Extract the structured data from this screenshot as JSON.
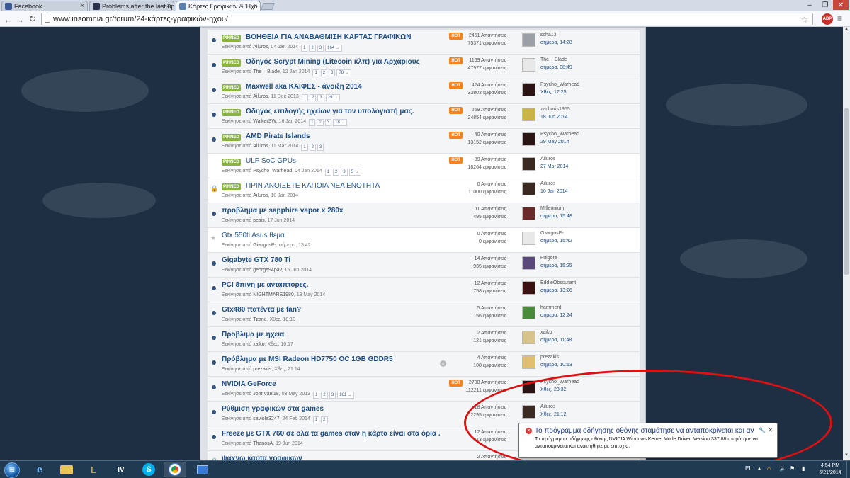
{
  "browser": {
    "tabs": [
      {
        "label": "Facebook",
        "color": "#3b5998"
      },
      {
        "label": "Problems after the last up",
        "color": "#2a2f4a"
      },
      {
        "label": "Κάρτες Γραφικών & Ήχο",
        "color": "#5a7fb0"
      }
    ],
    "url": "www.insomnia.gr/forum/24-κάρτες-γραφικών-ηχου/",
    "abp_label": "ABP"
  },
  "forum": {
    "pinned_label": "PINNED",
    "hot_label": "HOT",
    "started_by": "Ξεκίνησε από",
    "topics": [
      {
        "title": "ΒΟΗΘΕΙΑ ΓΙΑ ΑΝΑΒΑΘΜΙΣΗ ΚΑΡΤΑΣ ΓΡΑΦΙΚΩΝ",
        "pinned": true,
        "hot": true,
        "author": "Ailuros",
        "date": "04 Jan 2014",
        "pages": [
          "1",
          "2",
          "3",
          "164 →"
        ],
        "replies": "2451 Απαντήσεις",
        "views": "75371 εμφανίσεις",
        "last_user": "scha13",
        "last_date": "σήμερα, 14:28",
        "avatar": "#9aa0a6"
      },
      {
        "title": "Οδηγός Scrypt Mining (Litecoin κλπ) για Αρχάριους",
        "pinned": true,
        "hot": true,
        "author": "The__Blade",
        "date": "12 Jan 2014",
        "pages": [
          "1",
          "2",
          "3",
          "78 →"
        ],
        "replies": "1169 Απαντήσεις",
        "views": "47977 εμφανίσεις",
        "last_user": "The__Blade",
        "last_date": "σήμερα, 08:49",
        "avatar": "#e8e8e8"
      },
      {
        "title": "Maxwell aka ΚΑΙΦΕΣ - άνοιξη 2014",
        "pinned": true,
        "hot": true,
        "author": "Ailuros",
        "date": "11 Dec 2013",
        "pages": [
          "1",
          "2",
          "3",
          "29 →"
        ],
        "replies": "424 Απαντήσεις",
        "views": "33803 εμφανίσεις",
        "last_user": "Psycho_Warhead",
        "last_date": "Χθες, 17:25",
        "avatar": "#2a1414"
      },
      {
        "title": "Οδηγός επιλογής ηχείων για τον υπολογιστή μας.",
        "pinned": true,
        "hot": true,
        "author": "WalkerSW",
        "date": "16 Jan 2014",
        "pages": [
          "1",
          "2",
          "3",
          "18 →"
        ],
        "replies": "259 Απαντήσεις",
        "views": "24854 εμφανίσεις",
        "last_user": "zacharis1955",
        "last_date": "18 Jun 2014",
        "avatar": "#c9b44a"
      },
      {
        "title": "AMD Pirate Islands",
        "pinned": true,
        "hot": true,
        "author": "Ailuros",
        "date": "11 Mar 2014",
        "pages": [
          "1",
          "2",
          "3"
        ],
        "replies": "40 Απαντήσεις",
        "views": "13152 εμφανίσεις",
        "last_user": "Psycho_Warhead",
        "last_date": "29 May 2014",
        "avatar": "#2a1414"
      },
      {
        "title": "ULP SoC GPUs",
        "pinned": true,
        "hot": true,
        "light": true,
        "author": "Psycho_Warhead",
        "date": "04 Jan 2014",
        "pages": [
          "1",
          "2",
          "3",
          "5 →"
        ],
        "replies": "89 Απαντήσεις",
        "views": "18264 εμφανίσεις",
        "last_user": "Ailuros",
        "last_date": "27 Mar 2014",
        "avatar": "#3a2a22"
      },
      {
        "title": "ΠΡΙΝ ΑΝΟΙΞΕΤΕ ΚΑΠΟΙΑ ΝΕΑ ΕΝΟΤΗΤΑ",
        "pinned": true,
        "hot": false,
        "light": true,
        "locked": true,
        "author": "Ailuros",
        "date": "10 Jan 2014",
        "pages": [],
        "replies": "0 Απαντήσεις",
        "views": "11000 εμφανίσεις",
        "last_user": "Ailuros",
        "last_date": "10 Jan 2014",
        "avatar": "#3a2a22"
      },
      {
        "title": "προβλημα με sapphire vapor x 280x",
        "author": "pesis",
        "date": "17 Jun 2014",
        "pages": [],
        "replies": "11 Απαντήσεις",
        "views": "495 εμφανίσεις",
        "last_user": "Millennium",
        "last_date": "σήμερα, 15:48",
        "avatar": "#6b2a2a"
      },
      {
        "title": "Gtx 550ti Asus θεμα",
        "light": true,
        "star": true,
        "author": "GiwrgosP-",
        "date": "σήμερα, 15:42",
        "pages": [],
        "replies": "0 Απαντήσεις",
        "views": "0 εμφανίσεις",
        "last_user": "GiwrgosP-",
        "last_date": "σήμερα, 15:42",
        "avatar": "#e8e8e8"
      },
      {
        "title": "Gigabyte GTX 780 Ti",
        "author": "george94pav",
        "date": "15 Jun 2014",
        "pages": [],
        "replies": "14 Απαντήσεις",
        "views": "935 εμφανίσεις",
        "last_user": "Fulgore",
        "last_date": "σήμερα, 15:25",
        "avatar": "#5a4a7a"
      },
      {
        "title": "PCI 8πινη με ανταπτορες.",
        "author": "NIGHTMARE1980",
        "date": "13 May 2014",
        "pages": [],
        "replies": "12 Απαντήσεις",
        "views": "758 εμφανίσεις",
        "last_user": "EddieObscurant",
        "last_date": "σήμερα, 13:26",
        "avatar": "#3a1010"
      },
      {
        "title": "Gtx480 πατέντα με fan?",
        "author": "Tzane",
        "date": "Χθες, 18:10",
        "pages": [],
        "replies": "5 Απαντήσεις",
        "views": "156 εμφανίσεις",
        "last_user": "hammerd",
        "last_date": "σήμερα, 12:24",
        "avatar": "#4a8a3a"
      },
      {
        "title": "Προβλιμα με ηχεια",
        "author": "xaiko",
        "date": "Χθες, 16:17",
        "pages": [],
        "replies": "2 Απαντήσεις",
        "views": "121 εμφανίσεις",
        "last_user": "xaiko",
        "last_date": "σήμερα, 11:48",
        "avatar": "#d6c48a"
      },
      {
        "title": "Πρόβλημα με MSI Radeon HD7750 OC 1GB GDDR5",
        "mark": true,
        "author": "prezakis",
        "date": "Χθες, 21:14",
        "pages": [],
        "replies": "4 Απαντήσεις",
        "views": "108 εμφανίσεις",
        "last_user": "prezakis",
        "last_date": "σήμερα, 10:53",
        "avatar": "#e0c070"
      },
      {
        "title": "NVIDIA GeForce",
        "hot": true,
        "author": "JohnVani18",
        "date": "03 May 2013",
        "pages": [
          "1",
          "2",
          "3",
          "181 →"
        ],
        "replies": "2708 Απαντήσεις",
        "views": "112211 εμφανίσεις",
        "last_user": "Psycho_Warhead",
        "last_date": "Χθες, 23:32",
        "avatar": "#2a1414"
      },
      {
        "title": "Ρύθμιση γραφικών στα games",
        "author": "saviola3247",
        "date": "24 Feb 2014",
        "pages": [
          "1",
          "2"
        ],
        "replies": "18 Απαντήσεις",
        "views": "2295 εμφανίσεις",
        "last_user": "Ailuros",
        "last_date": "Χθες, 21:12",
        "avatar": "#3a2a22"
      },
      {
        "title": "Freeze με GTX 760 σε ολα τα games οταν η κάρτα είναι στα όρια .",
        "author": "ThanosA",
        "date": "19 Jun 2014",
        "pages": [],
        "replies": "12 Απαντήσεις",
        "views": "313 εμφανίσεις",
        "last_user": "",
        "last_date": "",
        "avatar": ""
      },
      {
        "title": "ψαχνω καρτα γραφικων",
        "locked": true,
        "author": "",
        "date": "",
        "pages": [],
        "replies": "2 Απαντήσεις",
        "views": "",
        "last_user": "",
        "last_date": "",
        "avatar": ""
      }
    ]
  },
  "notification": {
    "title": "Το πρόγραμμα οδήγησης οθόνης σταμάτησε να ανταποκρίνεται και αν",
    "body": "Το πρόγραμμα οδήγησης οθόνης NVIDIA Windows Kernel Mode Driver, Version 337.88  σταμάτησε να ανταποκρίνεται και ανακτήθηκε με επιτυχία."
  },
  "taskbar": {
    "lang": "EL",
    "time": "4:54 PM",
    "date": "6/21/2014"
  }
}
